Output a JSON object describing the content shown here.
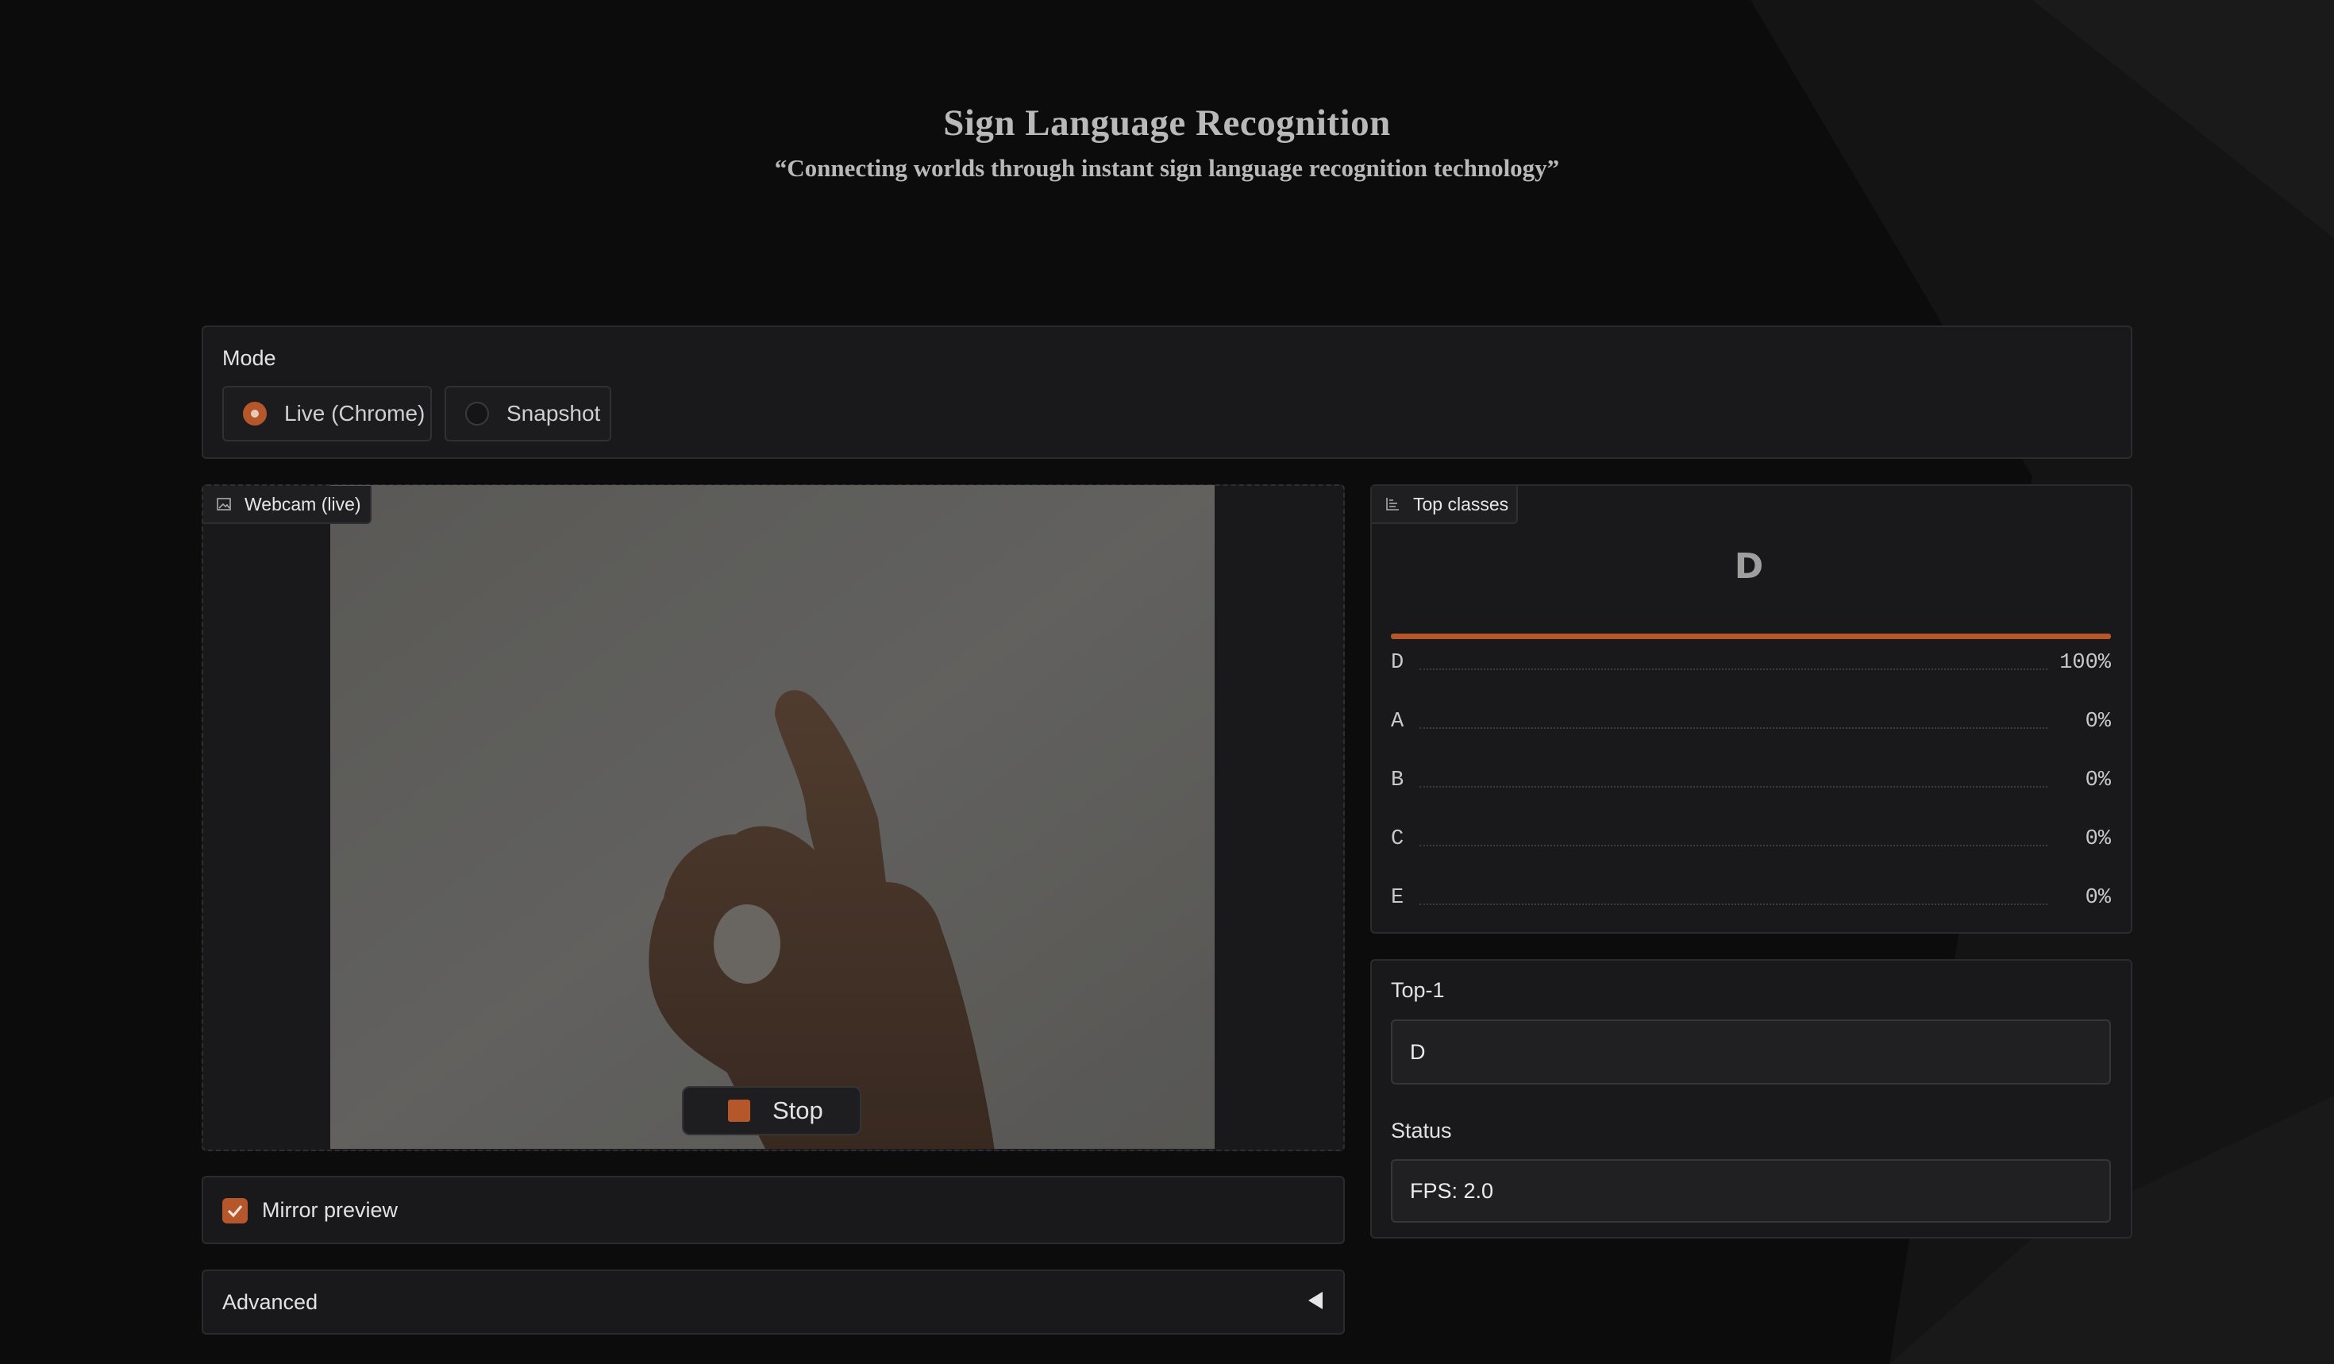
{
  "header": {
    "title": "Sign Language Recognition",
    "subtitle": "“Connecting worlds through instant sign language recognition technology”"
  },
  "mode": {
    "label": "Mode",
    "options": [
      {
        "label": "Live (Chrome)",
        "selected": true
      },
      {
        "label": "Snapshot",
        "selected": false
      }
    ]
  },
  "webcam": {
    "tag": "Webcam (live)",
    "tag_icon": "image-icon",
    "stop_label": "Stop"
  },
  "mirror": {
    "label": "Mirror preview",
    "checked": true
  },
  "advanced": {
    "label": "Advanced",
    "icon": "triangle-left-icon"
  },
  "top_classes": {
    "tag": "Top classes",
    "tag_icon": "bar-chart-icon",
    "predicted": "D",
    "top_confidence": 1.0,
    "rows": [
      {
        "name": "D",
        "value": "100%"
      },
      {
        "name": "A",
        "value": "0%"
      },
      {
        "name": "B",
        "value": "0%"
      },
      {
        "name": "C",
        "value": "0%"
      },
      {
        "name": "E",
        "value": "0%"
      }
    ]
  },
  "top1": {
    "label": "Top-1",
    "value": "D"
  },
  "status": {
    "label": "Status",
    "value": "FPS: 2.0"
  },
  "colors": {
    "accent": "#b5562b",
    "background": "#0c0c0d",
    "panel": "#19191b"
  }
}
